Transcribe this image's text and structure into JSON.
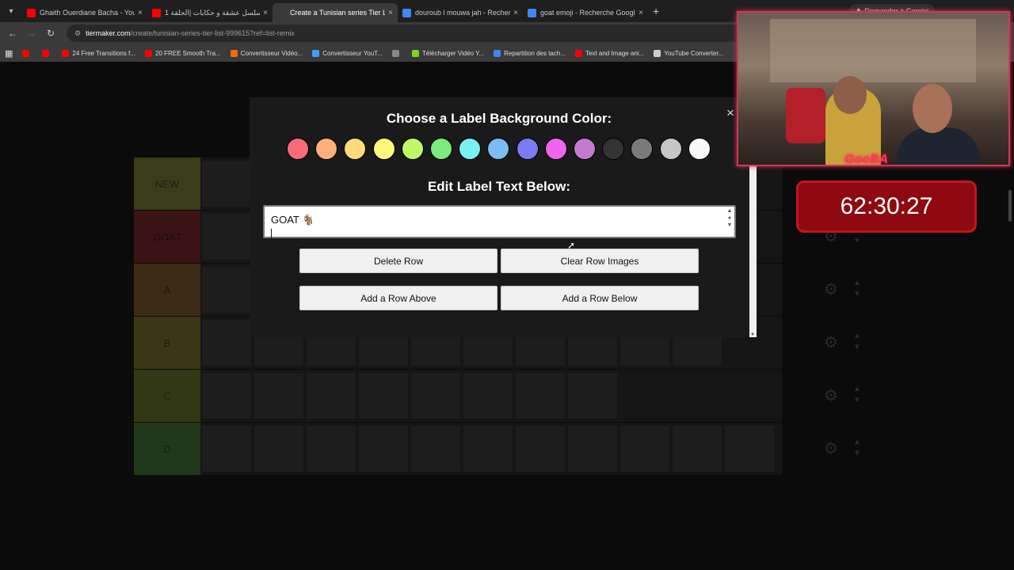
{
  "browser": {
    "tabs": [
      {
        "title": "Ghaith Ouerdiane Bacha - YouT",
        "favicon_color": "#ff0000",
        "active": false
      },
      {
        "title": "مسلسل عشقة و حكايات |الحلقة 1",
        "favicon_color": "#ff0000",
        "active": false
      },
      {
        "title": "Create a Tunisian series Tier Li",
        "favicon_color": "#3a3a3a",
        "active": true
      },
      {
        "title": "douroub l mouwa jah - Recherc",
        "favicon_color": "#4285f4",
        "active": false
      },
      {
        "title": "goat emoji - Recherche Google",
        "favicon_color": "#4285f4",
        "active": false
      }
    ],
    "gemini_label": "Demander à Gemini",
    "url_host": "tiermaker.com",
    "url_path": "/create/tunisian-series-tier-list-999615?ref=list-remix",
    "bookmarks": [
      {
        "label": "",
        "color": "#ff0000"
      },
      {
        "label": "",
        "color": "#ff0000"
      },
      {
        "label": "24 Free Transitions f...",
        "color": "#ff0000"
      },
      {
        "label": "20 FREE Smooth Tra...",
        "color": "#ff0000"
      },
      {
        "label": "Convertisseur Vidéo...",
        "color": "#ff6a00"
      },
      {
        "label": "Convertisseur YouT...",
        "color": "#3aa0ff"
      },
      {
        "label": "",
        "color": "#888888"
      },
      {
        "label": "Télécharger Vidéo Y...",
        "color": "#7ed321"
      },
      {
        "label": "Repartition des tach...",
        "color": "#4285f4"
      },
      {
        "label": "Text and Image ani...",
        "color": "#ff0000"
      },
      {
        "label": "YouTube Converter...",
        "color": "#cccccc"
      }
    ]
  },
  "tiers": [
    {
      "label": "NEW",
      "color": "#3a3d18"
    },
    {
      "label": "GOAT",
      "color": "#3a1414"
    },
    {
      "label": "A",
      "color": "#3b2a14"
    },
    {
      "label": "B",
      "color": "#3b3614"
    },
    {
      "label": "C",
      "color": "#333814"
    },
    {
      "label": "D",
      "color": "#20381a"
    }
  ],
  "modal": {
    "title": "Choose a Label Background Color:",
    "close_label": "×",
    "colors": [
      "#f76b7b",
      "#fdb07a",
      "#fddb7a",
      "#fdf87a",
      "#bef864",
      "#7bec7b",
      "#7bf0f0",
      "#7bbcf5",
      "#7b7bf5",
      "#f065f0",
      "#c37bd0",
      "#333333",
      "#7a7a7a",
      "#c6c6c6",
      "#f8f8f8"
    ],
    "edit_title": "Edit Label Text Below:",
    "label_text": "GOAT 🐐",
    "buttons": {
      "delete_row": "Delete Row",
      "clear_images": "Clear Row Images",
      "add_above": "Add a Row Above",
      "add_below": "Add a Row Below"
    }
  },
  "stream": {
    "cam_label": "GooBA",
    "timer": "62:30:27"
  }
}
